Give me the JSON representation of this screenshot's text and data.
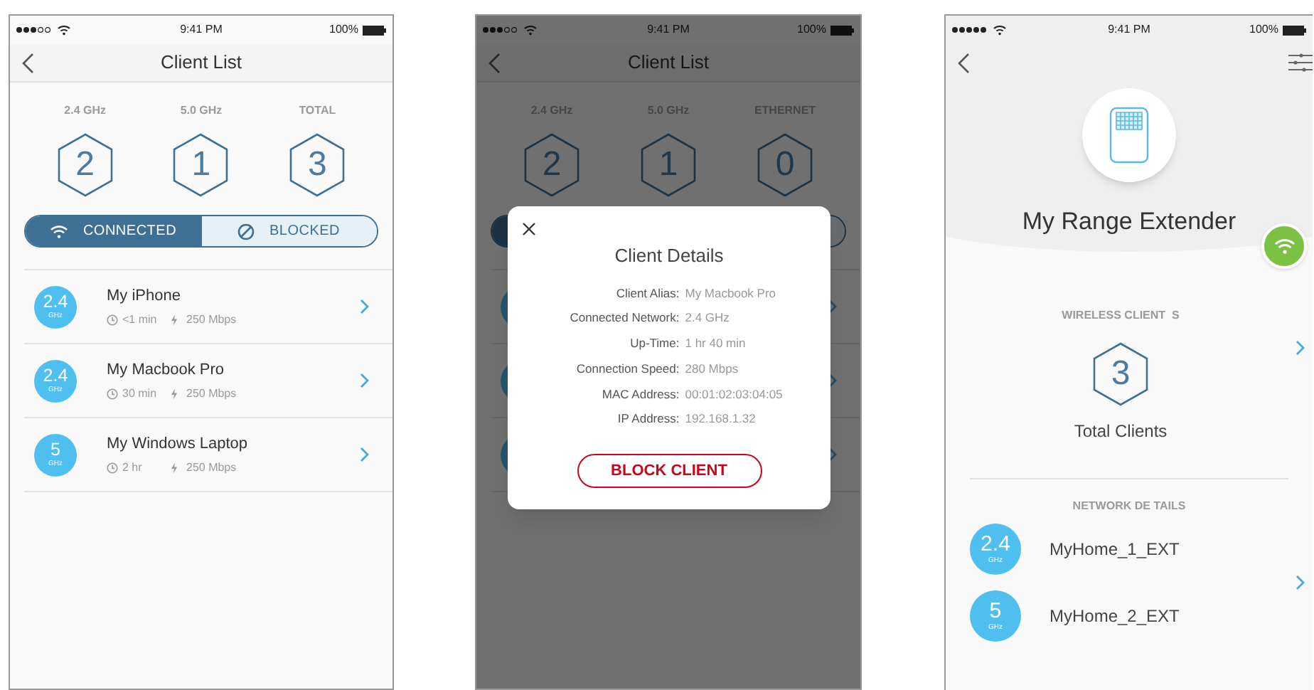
{
  "screens": [
    {
      "kind": "client_list",
      "status_bar": {
        "time": "9:41 PM",
        "battery": "100%"
      },
      "title": "Client List",
      "stats": [
        {
          "label": "2.4 GHz",
          "value": "2"
        },
        {
          "label": "5.0 GHz",
          "value": "1"
        },
        {
          "label": "TOTAL",
          "value": "3"
        }
      ],
      "segments": [
        {
          "label": "CONNECTED",
          "kind": "wifi",
          "selected": true
        },
        {
          "label": "BLOCKED",
          "kind": "block",
          "selected": false
        }
      ],
      "clients": [
        {
          "band": "2.4",
          "unit": "GHz",
          "name": "My iPhone",
          "uptime": "<1 min",
          "speed": "250 Mbps"
        },
        {
          "band": "2.4",
          "unit": "GHz",
          "name": "My Macbook Pro",
          "uptime": "30 min",
          "speed": "250 Mbps"
        },
        {
          "band": "5",
          "unit": "GHz",
          "name": "My Windows Laptop",
          "uptime": "2 hr",
          "speed": "250 Mbps"
        }
      ]
    },
    {
      "kind": "client_details",
      "status_bar": {
        "time": "9:41 PM",
        "battery": "100%"
      },
      "title": "Client List",
      "stats": [
        {
          "label": "2.4 GHz",
          "value": "2"
        },
        {
          "label": "5.0 GHz",
          "value": "1"
        },
        {
          "label": "ETHERNET",
          "value": "0"
        }
      ],
      "segments": [
        {
          "selected": true
        },
        {
          "selected": false
        }
      ],
      "modal": {
        "title": "Client Details",
        "fields": [
          {
            "label": "Client Alias:",
            "value": "My Macbook Pro"
          },
          {
            "label": "Connected Network:",
            "value": "2.4 GHz"
          },
          {
            "label": "Up-Time:",
            "value": "1 hr 40 min"
          },
          {
            "label": "Connection Speed:",
            "value": "280 Mbps"
          },
          {
            "label": "MAC Address:",
            "value": "00:01:02:03:04:05"
          },
          {
            "label": "IP Address:",
            "value": "192.168.1.32"
          }
        ],
        "action": "BLOCK CLIENT"
      }
    },
    {
      "kind": "device",
      "status_bar": {
        "time": "9:41 PM",
        "battery": "100%"
      },
      "device_name": "My Range Extender",
      "wireless_label": "WIRELESS CLIENT  S",
      "total": "3",
      "total_label": "Total Clients",
      "network_label": "NETWORK DE TAILS",
      "networks": [
        {
          "band": "2.4",
          "unit": "GHz",
          "name": "MyHome_1_EXT"
        },
        {
          "band": "5",
          "unit": "GHz",
          "name": "MyHome_2_EXT"
        }
      ]
    }
  ]
}
